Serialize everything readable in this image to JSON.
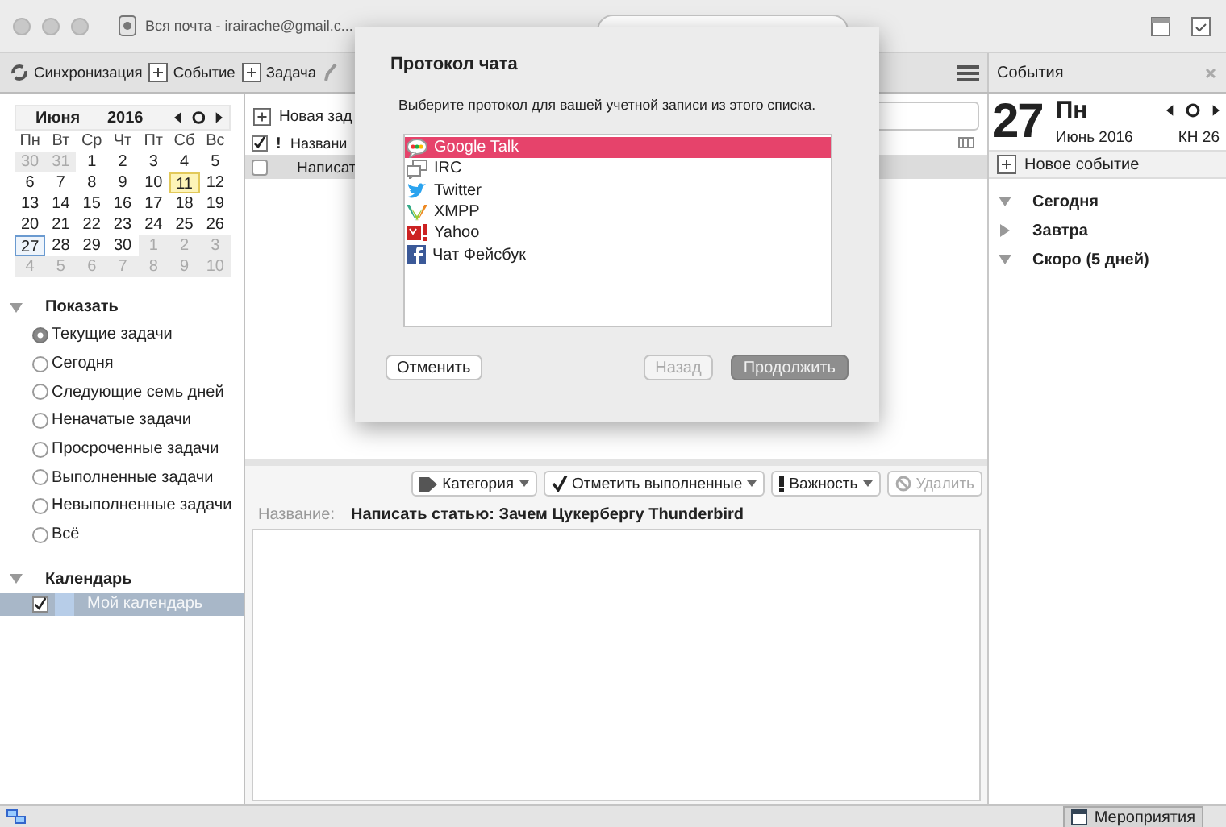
{
  "window": {
    "tab_title": "Вся почта - irairache@gmail.c..."
  },
  "toolbar": {
    "buttons": [
      {
        "label": "Синхронизация",
        "kind": "sync"
      },
      {
        "label": "Событие",
        "kind": "event"
      },
      {
        "label": "Задача",
        "kind": "task"
      }
    ]
  },
  "minimonth": {
    "month": "Июня",
    "year": "2016",
    "weekdays": [
      "Пн",
      "Вт",
      "Ср",
      "Чт",
      "Пт",
      "Сб",
      "Вс"
    ],
    "days": [
      {
        "label": "30",
        "outside": true,
        "selected": false,
        "highlighted": false
      },
      {
        "label": "31",
        "outside": true,
        "selected": false,
        "highlighted": false
      },
      {
        "label": "1",
        "outside": false,
        "selected": false,
        "highlighted": false
      },
      {
        "label": "2",
        "outside": false,
        "selected": false,
        "highlighted": false
      },
      {
        "label": "3",
        "outside": false,
        "selected": false,
        "highlighted": false
      },
      {
        "label": "4",
        "outside": false,
        "selected": false,
        "highlighted": false
      },
      {
        "label": "5",
        "outside": false,
        "selected": false,
        "highlighted": false
      },
      {
        "label": "6",
        "outside": false,
        "selected": false,
        "highlighted": false
      },
      {
        "label": "7",
        "outside": false,
        "selected": false,
        "highlighted": false
      },
      {
        "label": "8",
        "outside": false,
        "selected": false,
        "highlighted": false
      },
      {
        "label": "9",
        "outside": false,
        "selected": false,
        "highlighted": false
      },
      {
        "label": "10",
        "outside": false,
        "selected": false,
        "highlighted": false
      },
      {
        "label": "11",
        "outside": false,
        "selected": false,
        "highlighted": true
      },
      {
        "label": "12",
        "outside": false,
        "selected": false,
        "highlighted": false
      },
      {
        "label": "13",
        "outside": false,
        "selected": false,
        "highlighted": false
      },
      {
        "label": "14",
        "outside": false,
        "selected": false,
        "highlighted": false
      },
      {
        "label": "15",
        "outside": false,
        "selected": false,
        "highlighted": false
      },
      {
        "label": "16",
        "outside": false,
        "selected": false,
        "highlighted": false
      },
      {
        "label": "17",
        "outside": false,
        "selected": false,
        "highlighted": false
      },
      {
        "label": "18",
        "outside": false,
        "selected": false,
        "highlighted": false
      },
      {
        "label": "19",
        "outside": false,
        "selected": false,
        "highlighted": false
      },
      {
        "label": "20",
        "outside": false,
        "selected": false,
        "highlighted": false
      },
      {
        "label": "21",
        "outside": false,
        "selected": false,
        "highlighted": false
      },
      {
        "label": "22",
        "outside": false,
        "selected": false,
        "highlighted": false
      },
      {
        "label": "23",
        "outside": false,
        "selected": false,
        "highlighted": false
      },
      {
        "label": "24",
        "outside": false,
        "selected": false,
        "highlighted": false
      },
      {
        "label": "25",
        "outside": false,
        "selected": false,
        "highlighted": false
      },
      {
        "label": "26",
        "outside": false,
        "selected": false,
        "highlighted": false
      },
      {
        "label": "27",
        "outside": false,
        "selected": true,
        "highlighted": false
      },
      {
        "label": "28",
        "outside": false,
        "selected": false,
        "highlighted": false
      },
      {
        "label": "29",
        "outside": false,
        "selected": false,
        "highlighted": false
      },
      {
        "label": "30",
        "outside": false,
        "selected": false,
        "highlighted": false
      },
      {
        "label": "1",
        "outside": true,
        "selected": false,
        "highlighted": false
      },
      {
        "label": "2",
        "outside": true,
        "selected": false,
        "highlighted": false
      },
      {
        "label": "3",
        "outside": true,
        "selected": false,
        "highlighted": false
      },
      {
        "label": "4",
        "outside": true,
        "selected": false,
        "highlighted": false
      },
      {
        "label": "5",
        "outside": true,
        "selected": false,
        "highlighted": false
      },
      {
        "label": "6",
        "outside": true,
        "selected": false,
        "highlighted": false
      },
      {
        "label": "7",
        "outside": true,
        "selected": false,
        "highlighted": false
      },
      {
        "label": "8",
        "outside": true,
        "selected": false,
        "highlighted": false
      },
      {
        "label": "9",
        "outside": true,
        "selected": false,
        "highlighted": false
      },
      {
        "label": "10",
        "outside": true,
        "selected": false,
        "highlighted": false
      }
    ]
  },
  "filters": {
    "heading": "Показать",
    "expanded": true,
    "items": [
      {
        "label": "Текущие задачи",
        "selected": true
      },
      {
        "label": "Сегодня",
        "selected": false
      },
      {
        "label": "Следующие семь дней",
        "selected": false
      },
      {
        "label": "Неначатые задачи",
        "selected": false
      },
      {
        "label": "Просроченные задачи",
        "selected": false
      },
      {
        "label": "Выполненные задачи",
        "selected": false
      },
      {
        "label": "Невыполненные задачи",
        "selected": false
      },
      {
        "label": "Всё",
        "selected": false
      }
    ]
  },
  "calendars": {
    "heading": "Календарь",
    "expanded": true,
    "items": [
      {
        "label": "Мой календарь",
        "checked": true,
        "selected": true
      }
    ]
  },
  "tasks": {
    "new_task": "Новая зад",
    "columns": [
      {
        "label": "!",
        "kind": "priority"
      },
      {
        "label": "Названи",
        "kind": "title"
      }
    ],
    "rows": [
      {
        "title": "Написат",
        "checked": false,
        "selected": true
      }
    ]
  },
  "detail": {
    "actions": [
      {
        "label": "Категория",
        "kind": "category",
        "disabled": false,
        "menu": true
      },
      {
        "label": "Отметить выполненные",
        "kind": "done",
        "disabled": false,
        "menu": true
      },
      {
        "label": "Важность",
        "kind": "priority",
        "disabled": false,
        "menu": true
      },
      {
        "label": "Удалить",
        "kind": "delete",
        "disabled": true,
        "menu": false
      }
    ],
    "name_label": "Название:",
    "name_value": "Написать статью: Зачем Цукербергу Thunderbird"
  },
  "events": {
    "title": "События",
    "day": "27",
    "weekday": "Пн",
    "month_year": "Июнь 2016",
    "week": "КН 26",
    "new_event": "Новое событие",
    "groups": [
      {
        "label": "Сегодня",
        "expanded": true
      },
      {
        "label": "Завтра",
        "expanded": false
      },
      {
        "label": "Скоро (5 дней)",
        "expanded": true
      }
    ]
  },
  "status_bar": {
    "tab": "Мероприятия"
  },
  "dialog": {
    "title": "Протокол чата",
    "prompt": "Выберите протокол для вашей учетной записи из этого списка.",
    "protocols": [
      {
        "label": "Google Talk",
        "kind": "gtalk",
        "selected": true
      },
      {
        "label": "IRC",
        "kind": "irc",
        "selected": false
      },
      {
        "label": "Twitter",
        "kind": "twitter",
        "selected": false
      },
      {
        "label": "XMPP",
        "kind": "xmpp",
        "selected": false
      },
      {
        "label": "Yahoo",
        "kind": "yahoo",
        "selected": false
      },
      {
        "label": "Чат Фейсбук",
        "kind": "facebook",
        "selected": false
      }
    ],
    "buttons": [
      {
        "label": "Отменить",
        "disabled": false,
        "default": false
      },
      {
        "label": "Назад",
        "disabled": true,
        "default": false
      },
      {
        "label": "Продолжить",
        "disabled": true,
        "default": true
      }
    ]
  }
}
